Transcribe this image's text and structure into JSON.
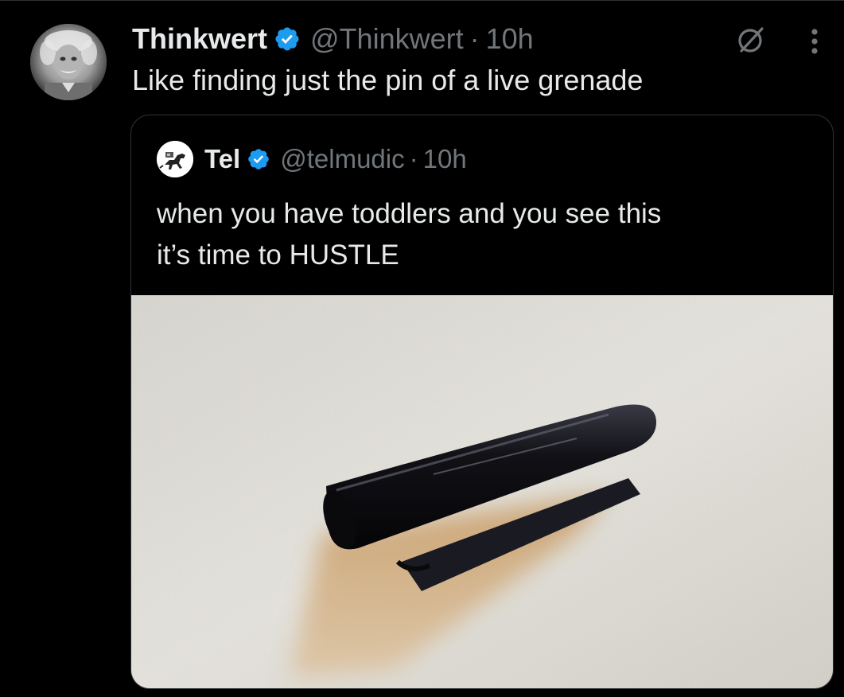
{
  "tweet": {
    "display_name": "Thinkwert",
    "handle": "@Thinkwert",
    "separator": "·",
    "time": "10h",
    "text": "Like finding just the pin of a live grenade",
    "avatar_icon": "profile-photo",
    "verified_icon": "verified-badge-icon",
    "grok_icon": "grok-icon",
    "more_icon": "more-dots-icon"
  },
  "quote": {
    "display_name": "Tel",
    "handle": "@telmudic",
    "separator": "·",
    "time": "10h",
    "text_lines": [
      "when you have toddlers and you see this",
      "it’s time to HUSTLE"
    ],
    "avatar_icon": "dinosaur-avatar",
    "media": "photo of a black pen cap lying on a white textured surface"
  },
  "colors": {
    "background": "#000000",
    "text": "#e7e9ea",
    "secondary_text": "#71767b",
    "border": "#2f3336",
    "verified_blue": "#1d9bf0"
  }
}
